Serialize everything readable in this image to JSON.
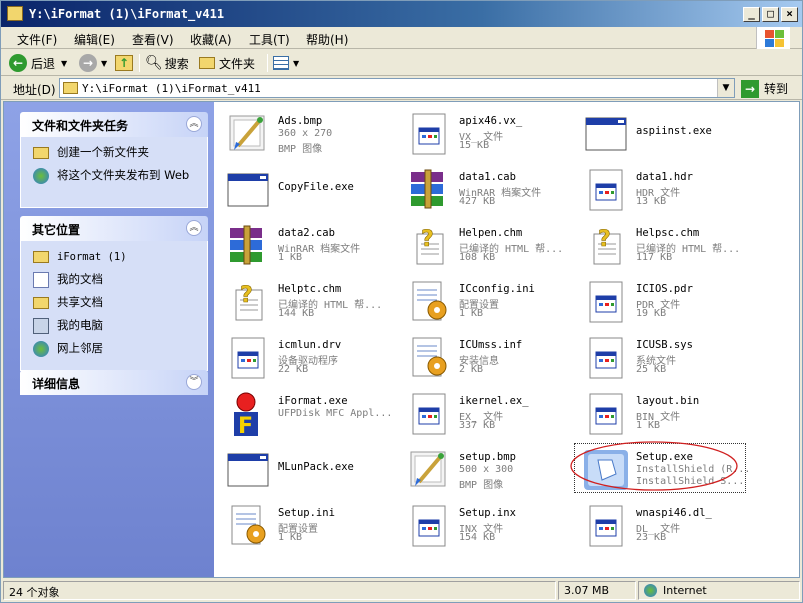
{
  "window": {
    "title": "Y:\\iFormat (1)\\iFormat_v411"
  },
  "menu": [
    {
      "label": "文件(F)"
    },
    {
      "label": "编辑(E)"
    },
    {
      "label": "查看(V)"
    },
    {
      "label": "收藏(A)"
    },
    {
      "label": "工具(T)"
    },
    {
      "label": "帮助(H)"
    }
  ],
  "toolbar": {
    "back": "后退",
    "search": "搜索",
    "folders": "文件夹"
  },
  "address": {
    "label": "地址(D)",
    "value": "Y:\\iFormat (1)\\iFormat_v411",
    "go": "转到"
  },
  "taskpane": {
    "file_tasks": {
      "title": "文件和文件夹任务",
      "items": [
        "创建一个新文件夹",
        "将这个文件夹发布到 Web"
      ]
    },
    "other_places": {
      "title": "其它位置",
      "items": [
        "iFormat (1)",
        "我的文档",
        "共享文档",
        "我的电脑",
        "网上邻居"
      ]
    },
    "details": {
      "title": "详细信息"
    }
  },
  "files": [
    {
      "name": "Ads.bmp",
      "type": "360 x 270",
      "size": "BMP 图像",
      "icon": "paint-brush-icon"
    },
    {
      "name": "apix46.vx_",
      "type": "VX_ 文件",
      "size": "15 KB",
      "icon": "generic-file-icon"
    },
    {
      "name": "aspiinst.exe",
      "type": "",
      "size": "",
      "icon": "exe-window-icon"
    },
    {
      "name": "CopyFile.exe",
      "type": "",
      "size": "",
      "icon": "exe-window-icon"
    },
    {
      "name": "data1.cab",
      "type": "WinRAR 档案文件",
      "size": "427 KB",
      "icon": "winrar-icon"
    },
    {
      "name": "data1.hdr",
      "type": "HDR 文件",
      "size": "13 KB",
      "icon": "generic-file-icon"
    },
    {
      "name": "data2.cab",
      "type": "WinRAR 档案文件",
      "size": "1 KB",
      "icon": "winrar-icon"
    },
    {
      "name": "Helpen.chm",
      "type": "已编译的 HTML 帮...",
      "size": "108 KB",
      "icon": "help-file-icon"
    },
    {
      "name": "Helpsc.chm",
      "type": "已编译的 HTML 帮...",
      "size": "117 KB",
      "icon": "help-file-icon"
    },
    {
      "name": "Helptc.chm",
      "type": "已编译的 HTML 帮...",
      "size": "144 KB",
      "icon": "help-file-icon"
    },
    {
      "name": "ICconfig.ini",
      "type": "配置设置",
      "size": "1 KB",
      "icon": "config-file-icon"
    },
    {
      "name": "ICIOS.pdr",
      "type": "PDR 文件",
      "size": "19 KB",
      "icon": "generic-file-icon"
    },
    {
      "name": "icmlun.drv",
      "type": "设备驱动程序",
      "size": "22 KB",
      "icon": "generic-file-icon"
    },
    {
      "name": "ICUmss.inf",
      "type": "安装信息",
      "size": "2 KB",
      "icon": "config-file-icon"
    },
    {
      "name": "ICUSB.sys",
      "type": "系统文件",
      "size": "25 KB",
      "icon": "generic-file-icon"
    },
    {
      "name": "iFormat.exe",
      "type": "UFPDisk MFC Appl...",
      "size": "",
      "icon": "iformat-app-icon"
    },
    {
      "name": "ikernel.ex_",
      "type": "EX_ 文件",
      "size": "337 KB",
      "icon": "generic-file-icon"
    },
    {
      "name": "layout.bin",
      "type": "BIN 文件",
      "size": "1 KB",
      "icon": "generic-file-icon"
    },
    {
      "name": "MLunPack.exe",
      "type": "",
      "size": "",
      "icon": "exe-window-icon"
    },
    {
      "name": "setup.bmp",
      "type": "500 x 300",
      "size": "BMP 图像",
      "icon": "paint-brush-icon"
    },
    {
      "name": "Setup.exe",
      "type": "InstallShield (R...",
      "size": "InstallShield S...",
      "icon": "installshield-icon",
      "selected": true
    },
    {
      "name": "Setup.ini",
      "type": "配置设置",
      "size": "1 KB",
      "icon": "config-file-icon"
    },
    {
      "name": "Setup.inx",
      "type": "INX 文件",
      "size": "154 KB",
      "icon": "generic-file-icon"
    },
    {
      "name": "wnaspi46.dl_",
      "type": "DL_ 文件",
      "size": "23 KB",
      "icon": "generic-file-icon"
    }
  ],
  "status": {
    "count": "24 个对象",
    "size": "3.07 MB",
    "zone": "Internet"
  },
  "colors": {
    "title_start": "#0a246a",
    "title_end": "#a6caf0",
    "taskpane": "#7c8fd8",
    "annotation_circle": "#d02020"
  }
}
